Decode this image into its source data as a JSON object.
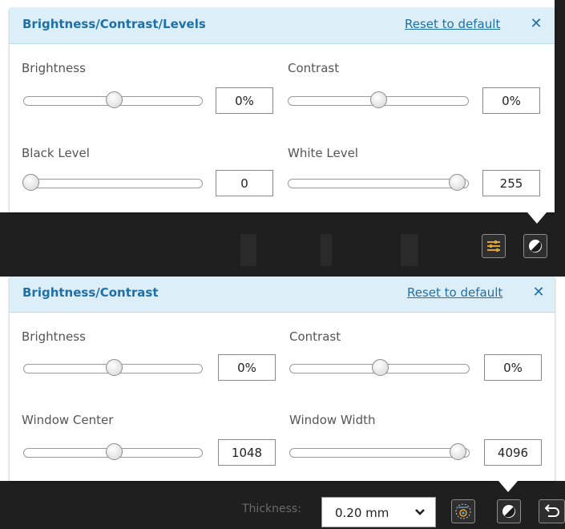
{
  "panel_levels": {
    "title": "Brightness/Contrast/Levels",
    "reset_label": "Reset to default",
    "close_symbol": "✕",
    "controls": [
      {
        "label": "Brightness",
        "value": "0%",
        "level": 0.5
      },
      {
        "label": "Contrast",
        "value": "0%",
        "level": 0.5
      },
      {
        "label": "Black Level",
        "value": "0",
        "level": 0.0
      },
      {
        "label": "White Level",
        "value": "255",
        "level": 1.0
      }
    ]
  },
  "panel_contrast": {
    "title": "Brightness/Contrast",
    "reset_label": "Reset to default",
    "close_symbol": "✕",
    "controls": [
      {
        "label": "Brightness",
        "value": "0%",
        "level": 0.5
      },
      {
        "label": "Contrast",
        "value": "0%",
        "level": 0.5
      },
      {
        "label": "Window Center",
        "value": "1048",
        "level": 0.5
      },
      {
        "label": "Window Width",
        "value": "4096",
        "level": 1.0
      }
    ]
  },
  "toolbar": {
    "thickness_label": "Thickness:",
    "thickness_value": "0.20 mm",
    "thickness_options": [
      "0.20 mm"
    ]
  },
  "icons": [
    "sliders-icon",
    "contrast-icon",
    "render-mode-icon",
    "undo-icon",
    "chevron-down-icon",
    "close-icon"
  ],
  "colors": {
    "accent": "#1f6fa8",
    "header_bg": "#dceef8",
    "toolbar_bg": "#1f1f1f",
    "sliders_icon": "#e3a32b"
  }
}
